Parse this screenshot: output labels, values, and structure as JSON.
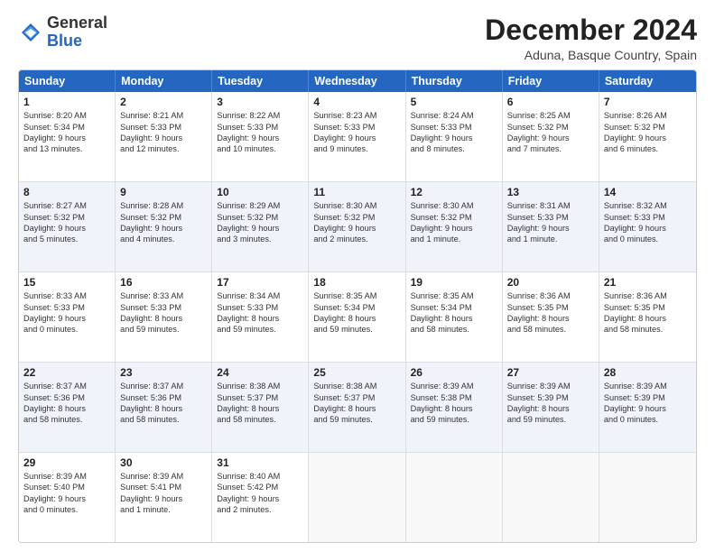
{
  "header": {
    "logo_general": "General",
    "logo_blue": "Blue",
    "month_title": "December 2024",
    "location": "Aduna, Basque Country, Spain"
  },
  "days_of_week": [
    "Sunday",
    "Monday",
    "Tuesday",
    "Wednesday",
    "Thursday",
    "Friday",
    "Saturday"
  ],
  "rows": [
    {
      "alt": false,
      "cells": [
        {
          "day": "1",
          "lines": [
            "Sunrise: 8:20 AM",
            "Sunset: 5:34 PM",
            "Daylight: 9 hours",
            "and 13 minutes."
          ]
        },
        {
          "day": "2",
          "lines": [
            "Sunrise: 8:21 AM",
            "Sunset: 5:33 PM",
            "Daylight: 9 hours",
            "and 12 minutes."
          ]
        },
        {
          "day": "3",
          "lines": [
            "Sunrise: 8:22 AM",
            "Sunset: 5:33 PM",
            "Daylight: 9 hours",
            "and 10 minutes."
          ]
        },
        {
          "day": "4",
          "lines": [
            "Sunrise: 8:23 AM",
            "Sunset: 5:33 PM",
            "Daylight: 9 hours",
            "and 9 minutes."
          ]
        },
        {
          "day": "5",
          "lines": [
            "Sunrise: 8:24 AM",
            "Sunset: 5:33 PM",
            "Daylight: 9 hours",
            "and 8 minutes."
          ]
        },
        {
          "day": "6",
          "lines": [
            "Sunrise: 8:25 AM",
            "Sunset: 5:32 PM",
            "Daylight: 9 hours",
            "and 7 minutes."
          ]
        },
        {
          "day": "7",
          "lines": [
            "Sunrise: 8:26 AM",
            "Sunset: 5:32 PM",
            "Daylight: 9 hours",
            "and 6 minutes."
          ]
        }
      ]
    },
    {
      "alt": true,
      "cells": [
        {
          "day": "8",
          "lines": [
            "Sunrise: 8:27 AM",
            "Sunset: 5:32 PM",
            "Daylight: 9 hours",
            "and 5 minutes."
          ]
        },
        {
          "day": "9",
          "lines": [
            "Sunrise: 8:28 AM",
            "Sunset: 5:32 PM",
            "Daylight: 9 hours",
            "and 4 minutes."
          ]
        },
        {
          "day": "10",
          "lines": [
            "Sunrise: 8:29 AM",
            "Sunset: 5:32 PM",
            "Daylight: 9 hours",
            "and 3 minutes."
          ]
        },
        {
          "day": "11",
          "lines": [
            "Sunrise: 8:30 AM",
            "Sunset: 5:32 PM",
            "Daylight: 9 hours",
            "and 2 minutes."
          ]
        },
        {
          "day": "12",
          "lines": [
            "Sunrise: 8:30 AM",
            "Sunset: 5:32 PM",
            "Daylight: 9 hours",
            "and 1 minute."
          ]
        },
        {
          "day": "13",
          "lines": [
            "Sunrise: 8:31 AM",
            "Sunset: 5:33 PM",
            "Daylight: 9 hours",
            "and 1 minute."
          ]
        },
        {
          "day": "14",
          "lines": [
            "Sunrise: 8:32 AM",
            "Sunset: 5:33 PM",
            "Daylight: 9 hours",
            "and 0 minutes."
          ]
        }
      ]
    },
    {
      "alt": false,
      "cells": [
        {
          "day": "15",
          "lines": [
            "Sunrise: 8:33 AM",
            "Sunset: 5:33 PM",
            "Daylight: 9 hours",
            "and 0 minutes."
          ]
        },
        {
          "day": "16",
          "lines": [
            "Sunrise: 8:33 AM",
            "Sunset: 5:33 PM",
            "Daylight: 8 hours",
            "and 59 minutes."
          ]
        },
        {
          "day": "17",
          "lines": [
            "Sunrise: 8:34 AM",
            "Sunset: 5:33 PM",
            "Daylight: 8 hours",
            "and 59 minutes."
          ]
        },
        {
          "day": "18",
          "lines": [
            "Sunrise: 8:35 AM",
            "Sunset: 5:34 PM",
            "Daylight: 8 hours",
            "and 59 minutes."
          ]
        },
        {
          "day": "19",
          "lines": [
            "Sunrise: 8:35 AM",
            "Sunset: 5:34 PM",
            "Daylight: 8 hours",
            "and 58 minutes."
          ]
        },
        {
          "day": "20",
          "lines": [
            "Sunrise: 8:36 AM",
            "Sunset: 5:35 PM",
            "Daylight: 8 hours",
            "and 58 minutes."
          ]
        },
        {
          "day": "21",
          "lines": [
            "Sunrise: 8:36 AM",
            "Sunset: 5:35 PM",
            "Daylight: 8 hours",
            "and 58 minutes."
          ]
        }
      ]
    },
    {
      "alt": true,
      "cells": [
        {
          "day": "22",
          "lines": [
            "Sunrise: 8:37 AM",
            "Sunset: 5:36 PM",
            "Daylight: 8 hours",
            "and 58 minutes."
          ]
        },
        {
          "day": "23",
          "lines": [
            "Sunrise: 8:37 AM",
            "Sunset: 5:36 PM",
            "Daylight: 8 hours",
            "and 58 minutes."
          ]
        },
        {
          "day": "24",
          "lines": [
            "Sunrise: 8:38 AM",
            "Sunset: 5:37 PM",
            "Daylight: 8 hours",
            "and 58 minutes."
          ]
        },
        {
          "day": "25",
          "lines": [
            "Sunrise: 8:38 AM",
            "Sunset: 5:37 PM",
            "Daylight: 8 hours",
            "and 59 minutes."
          ]
        },
        {
          "day": "26",
          "lines": [
            "Sunrise: 8:39 AM",
            "Sunset: 5:38 PM",
            "Daylight: 8 hours",
            "and 59 minutes."
          ]
        },
        {
          "day": "27",
          "lines": [
            "Sunrise: 8:39 AM",
            "Sunset: 5:39 PM",
            "Daylight: 8 hours",
            "and 59 minutes."
          ]
        },
        {
          "day": "28",
          "lines": [
            "Sunrise: 8:39 AM",
            "Sunset: 5:39 PM",
            "Daylight: 9 hours",
            "and 0 minutes."
          ]
        }
      ]
    },
    {
      "alt": false,
      "cells": [
        {
          "day": "29",
          "lines": [
            "Sunrise: 8:39 AM",
            "Sunset: 5:40 PM",
            "Daylight: 9 hours",
            "and 0 minutes."
          ]
        },
        {
          "day": "30",
          "lines": [
            "Sunrise: 8:39 AM",
            "Sunset: 5:41 PM",
            "Daylight: 9 hours",
            "and 1 minute."
          ]
        },
        {
          "day": "31",
          "lines": [
            "Sunrise: 8:40 AM",
            "Sunset: 5:42 PM",
            "Daylight: 9 hours",
            "and 2 minutes."
          ]
        },
        {
          "day": "",
          "lines": []
        },
        {
          "day": "",
          "lines": []
        },
        {
          "day": "",
          "lines": []
        },
        {
          "day": "",
          "lines": []
        }
      ]
    }
  ]
}
